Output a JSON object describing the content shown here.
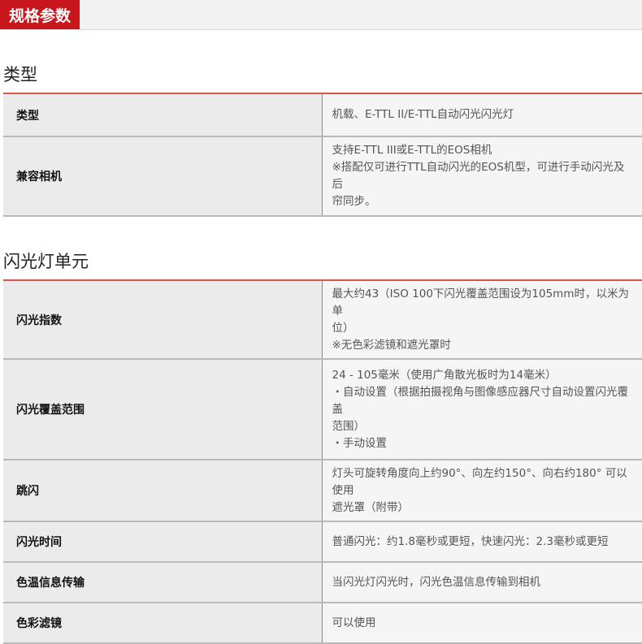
{
  "header": {
    "tab_label": "规格参数"
  },
  "sections": [
    {
      "title": "类型",
      "rows": [
        {
          "label": "类型",
          "lines": [
            "机载、E-TTL II/E-TTL自动闪光闪光灯"
          ]
        },
        {
          "label": "兼容相机",
          "lines": [
            "支持E-TTL III或E-TTL的EOS相机",
            "※搭配仅可进行TTL自动闪光的EOS机型，可进行手动闪光及后",
            "帘同步。"
          ]
        }
      ]
    },
    {
      "title": "闪光灯单元",
      "rows": [
        {
          "label": "闪光指数",
          "lines": [
            "最大约43（ISO 100下闪光覆盖范围设为105mm时，以米为单",
            "位）",
            "※无色彩滤镜和遮光罩时"
          ]
        },
        {
          "label": "闪光覆盖范围",
          "lines": [
            "24 - 105毫米（使用广角散光板时为14毫米）",
            "・自动设置（根据拍摄视角与图像感应器尺寸自动设置闪光覆盖",
            "范围）",
            "・手动设置"
          ]
        },
        {
          "label": "跳闪",
          "lines": [
            "灯头可旋转角度向上约90°、向左约150°、向右约180° 可以使用",
            "遮光罩（附带）"
          ]
        },
        {
          "label": "闪光时间",
          "lines": [
            "普通闪光：约1.8毫秒或更短，快速闪光：2.3毫秒或更短"
          ]
        },
        {
          "label": "色温信息传输",
          "lines": [
            "当闪光灯闪光时，闪光色温信息传输到相机"
          ]
        },
        {
          "label": "色彩滤镜",
          "lines": [
            "可以使用"
          ]
        }
      ]
    }
  ]
}
